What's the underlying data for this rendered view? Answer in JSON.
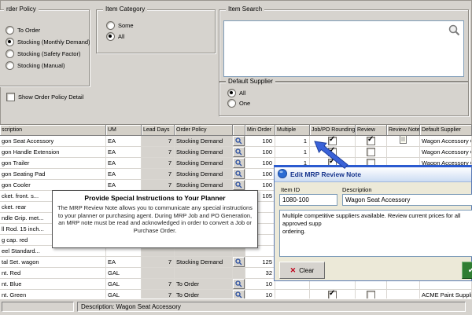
{
  "order_policy": {
    "title": "rder Policy",
    "options": [
      {
        "label": "To Order",
        "selected": false
      },
      {
        "label": "Stocking (Monthly Demand)",
        "selected": true
      },
      {
        "label": "Stocking (Safety Factor)",
        "selected": false
      },
      {
        "label": "Stocking (Manual)",
        "selected": false
      }
    ],
    "detail_checkbox": {
      "label": "Show Order Policy Detail",
      "checked": false
    }
  },
  "item_category": {
    "title": "Item Category",
    "options": [
      {
        "label": "Some",
        "selected": false
      },
      {
        "label": "All",
        "selected": true
      }
    ]
  },
  "item_search": {
    "title": "Item Search"
  },
  "default_supplier": {
    "title": "Default Supplier",
    "options": [
      {
        "label": "All",
        "selected": true
      },
      {
        "label": "One",
        "selected": false
      }
    ]
  },
  "grid": {
    "headers": [
      "scription",
      "UM",
      "Lead Days",
      "Order Policy",
      "",
      "Min Order",
      "Multiple",
      "Job/PO Rounding",
      "Review",
      "Review Note",
      "Default Supplier"
    ],
    "rows": [
      {
        "desc": "gon Seat Accessory",
        "um": "EA",
        "lead": "7",
        "policy": "Stocking Demand",
        "lookup": true,
        "min": "100",
        "mult": "1",
        "round": true,
        "review": true,
        "note": true,
        "supplier": "Wagon Accessory Company"
      },
      {
        "desc": "gon Handle Extension",
        "um": "EA",
        "lead": "7",
        "policy": "Stocking Demand",
        "lookup": true,
        "min": "100",
        "mult": "1",
        "round": true,
        "review": false,
        "note": false,
        "supplier": "Wagon Accessory Company"
      },
      {
        "desc": "gon Trailer",
        "um": "EA",
        "lead": "7",
        "policy": "Stocking Demand",
        "lookup": true,
        "min": "100",
        "mult": "1",
        "round": true,
        "review": false,
        "note": false,
        "supplier": "Wagon Accessory Company"
      },
      {
        "desc": "gon Seating Pad",
        "um": "EA",
        "lead": "7",
        "policy": "Stocking Demand",
        "lookup": true,
        "min": "100",
        "mult": "",
        "round": null,
        "review": null,
        "note": false,
        "supplier": ""
      },
      {
        "desc": "gon Cooler",
        "um": "EA",
        "lead": "7",
        "policy": "Stocking Demand",
        "lookup": true,
        "min": "100",
        "mult": "",
        "round": null,
        "review": null,
        "note": false,
        "supplier": ""
      },
      {
        "desc": "cket. front. s...",
        "um": "EA",
        "lead": "7",
        "policy": "Stocking Demand",
        "lookup": true,
        "min": "105",
        "mult": "",
        "round": null,
        "review": null,
        "note": false,
        "supplier": ""
      },
      {
        "desc": "cket. rear",
        "um": "",
        "lead": "",
        "policy": "",
        "lookup": false,
        "min": "",
        "mult": "",
        "round": null,
        "review": null,
        "note": false,
        "supplier": ""
      },
      {
        "desc": "ndle Grip. met...",
        "um": "",
        "lead": "",
        "policy": "",
        "lookup": false,
        "min": "",
        "mult": "",
        "round": null,
        "review": null,
        "note": false,
        "supplier": ""
      },
      {
        "desc": "ll Rod. 15 inch...",
        "um": "",
        "lead": "",
        "policy": "",
        "lookup": false,
        "min": "",
        "mult": "",
        "round": null,
        "review": null,
        "note": false,
        "supplier": ""
      },
      {
        "desc": "g cap. red",
        "um": "",
        "lead": "",
        "policy": "",
        "lookup": false,
        "min": "",
        "mult": "",
        "round": null,
        "review": null,
        "note": false,
        "supplier": ""
      },
      {
        "desc": "eel Standard...",
        "um": "",
        "lead": "",
        "policy": "",
        "lookup": false,
        "min": "",
        "mult": "",
        "round": null,
        "review": null,
        "note": false,
        "supplier": ""
      },
      {
        "desc": "tal Set. wagon",
        "um": "EA",
        "lead": "7",
        "policy": "Stocking Demand",
        "lookup": true,
        "min": "125",
        "mult": "",
        "round": null,
        "review": null,
        "note": false,
        "supplier": ""
      },
      {
        "desc": "nt. Red",
        "um": "GAL",
        "lead": "",
        "policy": "",
        "lookup": false,
        "min": "32",
        "mult": "",
        "round": null,
        "review": null,
        "note": false,
        "supplier": ""
      },
      {
        "desc": "nt. Blue",
        "um": "GAL",
        "lead": "7",
        "policy": "To Order",
        "lookup": true,
        "min": "10",
        "mult": "",
        "round": null,
        "review": null,
        "note": false,
        "supplier": ""
      },
      {
        "desc": "nt. Green",
        "um": "GAL",
        "lead": "7",
        "policy": "To Order",
        "lookup": true,
        "min": "10",
        "mult": "",
        "round": true,
        "review": false,
        "note": false,
        "supplier": "ACME Paint Supplies"
      }
    ]
  },
  "callout": {
    "title": "Provide Special Instructions to Your Planner",
    "body": "The MRP Review Note allows you to communicate any special instructions to your planner or purchasing agent.  During MRP Job and PO Generation, an MRP note must be read and acknowledged in order to convert a Job or Purchase Order."
  },
  "dialog": {
    "title": "Edit MRP Review Note",
    "fields": {
      "item_id_label": "Item ID",
      "item_id_value": "1080-100",
      "description_label": "Description",
      "description_value": "Wagon Seat Accessory"
    },
    "note_text": "Multiple competitive suppliers available.  Review current prices for all approved supp\nordering.",
    "buttons": {
      "clear": "Clear"
    }
  },
  "statusbar": {
    "description": "Description: Wagon Seat Accessory"
  }
}
